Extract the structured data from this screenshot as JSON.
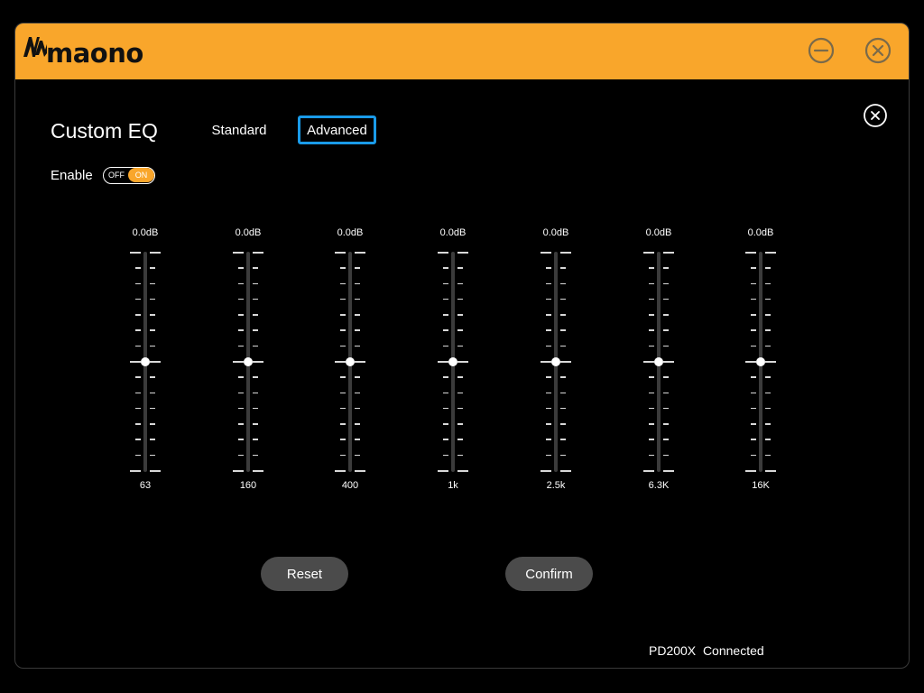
{
  "app": {
    "logo_text": "maono",
    "brand_color": "#f9a62b",
    "accent_color": "#1a9be9"
  },
  "titlebar": {
    "minimize_icon": "minimize-circle-icon",
    "close_icon": "close-circle-icon"
  },
  "panel": {
    "title": "Custom EQ",
    "tabs": [
      {
        "label": "Standard",
        "selected": false
      },
      {
        "label": "Advanced",
        "selected": true
      }
    ],
    "close_icon": "close-circle-icon"
  },
  "enable": {
    "label": "Enable",
    "off_label": "OFF",
    "on_label": "ON",
    "state": "on"
  },
  "bands": [
    {
      "freq": "63",
      "gain_label": "0.0dB",
      "gain_db": 0.0
    },
    {
      "freq": "160",
      "gain_label": "0.0dB",
      "gain_db": 0.0
    },
    {
      "freq": "400",
      "gain_label": "0.0dB",
      "gain_db": 0.0
    },
    {
      "freq": "1k",
      "gain_label": "0.0dB",
      "gain_db": 0.0
    },
    {
      "freq": "2.5k",
      "gain_label": "0.0dB",
      "gain_db": 0.0
    },
    {
      "freq": "6.3K",
      "gain_label": "0.0dB",
      "gain_db": 0.0
    },
    {
      "freq": "16K",
      "gain_label": "0.0dB",
      "gain_db": 0.0
    }
  ],
  "actions": {
    "reset_label": "Reset",
    "confirm_label": "Confirm"
  },
  "status": {
    "device": "PD200X",
    "connection": "Connected"
  }
}
